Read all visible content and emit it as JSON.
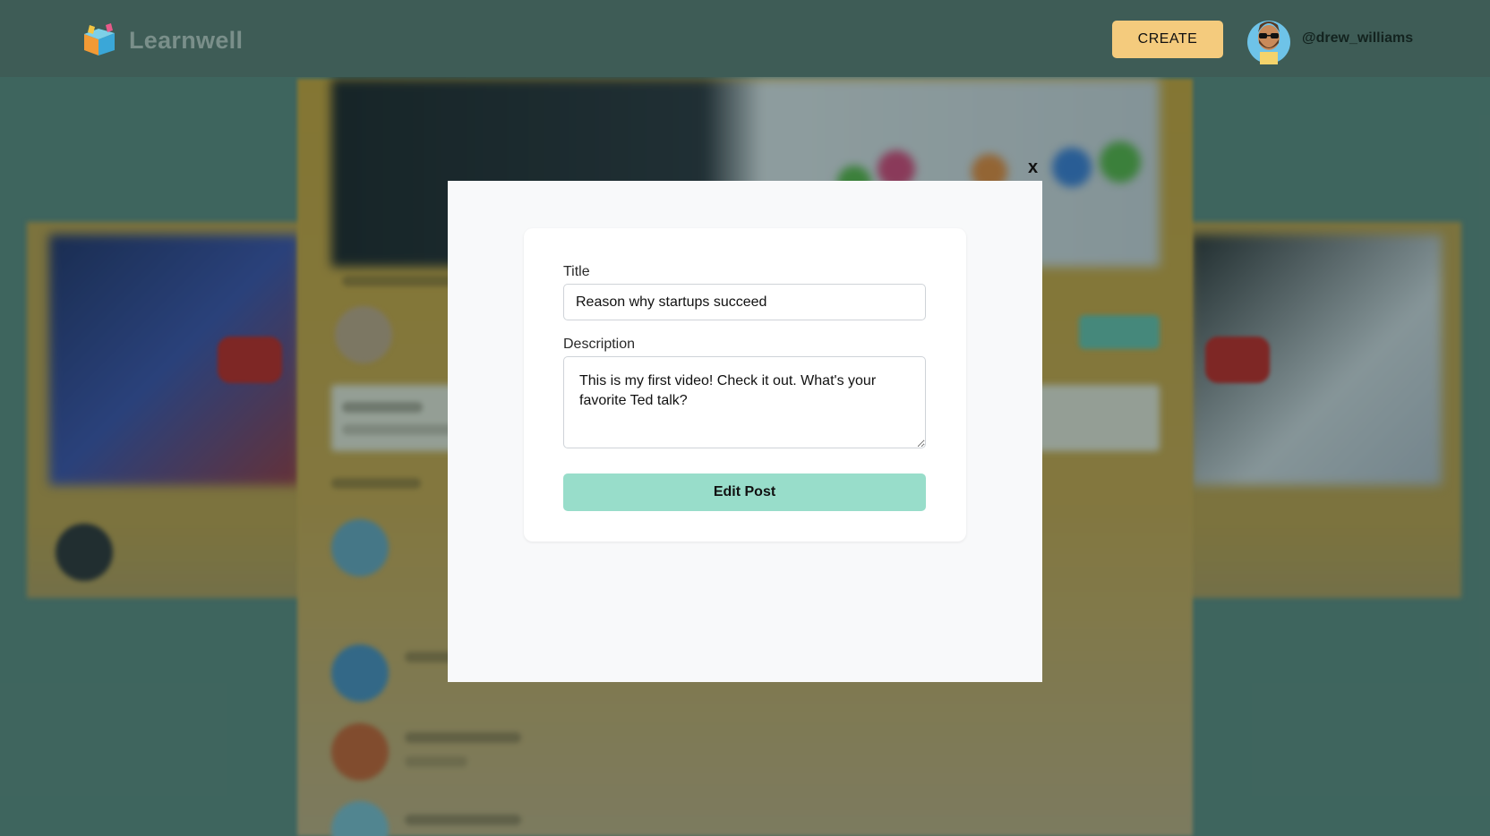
{
  "header": {
    "brand": "Learnwell",
    "create_label": "CREATE",
    "username": "@drew_williams"
  },
  "modal": {
    "close_label": "x",
    "title_label": "Title",
    "title_value": "Reason why startups succeed",
    "description_label": "Description",
    "description_value": "This is my first video! Check it out. What's your favorite Ted talk?",
    "submit_label": "Edit Post"
  },
  "colors": {
    "header_bg": "#3e5c56",
    "create_button": "#f4cb7d",
    "submit_button": "#98ddca",
    "card_gold": "#d6a838"
  },
  "icons": {
    "logo": "learnwell-cube-logo-icon",
    "avatar": "bearded-man-sunglasses-avatar"
  }
}
